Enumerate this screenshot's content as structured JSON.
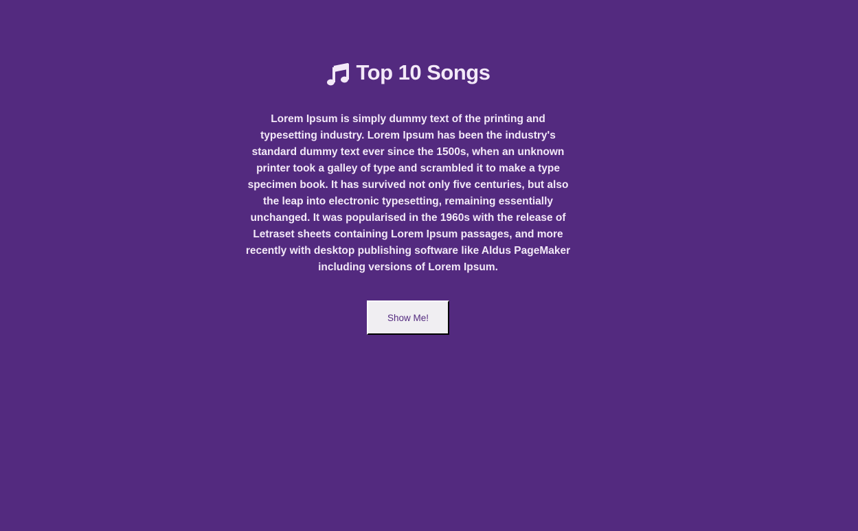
{
  "header": {
    "icon": "music-note-icon",
    "title": "Top 10 Songs"
  },
  "main": {
    "description": "Lorem Ipsum is simply dummy text of the printing and typesetting industry. Lorem Ipsum has been the industry's standard dummy text ever since the 1500s, when an unknown printer took a galley of type and scrambled it to make a type specimen book. It has survived not only five centuries, but also the leap into electronic typesetting, remaining essentially unchanged. It was popularised in the 1960s with the release of Letraset sheets containing Lorem Ipsum passages, and more recently with desktop publishing software like Aldus PageMaker including versions of Lorem Ipsum.",
    "button_label": "Show Me!"
  },
  "colors": {
    "background": "#532a7f",
    "text": "#f3e9f8",
    "button_background": "#f0eef2",
    "button_text": "#532a7f"
  }
}
